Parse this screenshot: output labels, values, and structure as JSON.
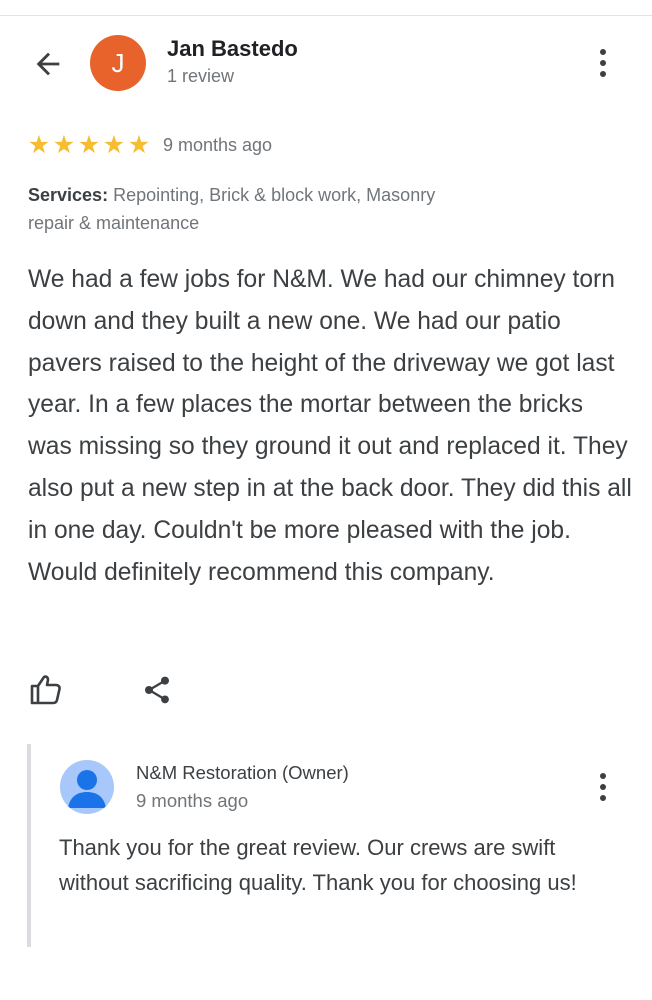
{
  "reviewer": {
    "initial": "J",
    "name": "Jan Bastedo",
    "review_count": "1 review",
    "avatar_color": "#e8622c"
  },
  "review": {
    "rating": 5,
    "stars": [
      "★",
      "★",
      "★",
      "★",
      "★"
    ],
    "star_color": "#f5bd2f",
    "time": "9 months ago",
    "services_label": "Services:",
    "services_value": "Repointing, Brick & block work, Masonry repair & maintenance",
    "text": "We had a few jobs for N&M. We had our chimney torn down and they built a new one. We had our patio pavers raised to the height of the driveway we got last year. In a few places the mortar between the bricks was missing so they ground it out and replaced it. They also put a new step in at the back door. They did this all in one day. Couldn't be more pleased with the job. Would definitely recommend this company."
  },
  "actions": {
    "like_icon": "thumbs-up-icon",
    "share_icon": "share-icon"
  },
  "owner_reply": {
    "name": "N&M Restoration (Owner)",
    "time": "9 months ago",
    "text": "Thank you for the great review. Our crews are swift without sacrificing quality. Thank you for choosing us!",
    "avatar_color": "#a8c7fa"
  },
  "icons": {
    "back": "arrow-back-icon",
    "more": "more-vert-icon"
  }
}
